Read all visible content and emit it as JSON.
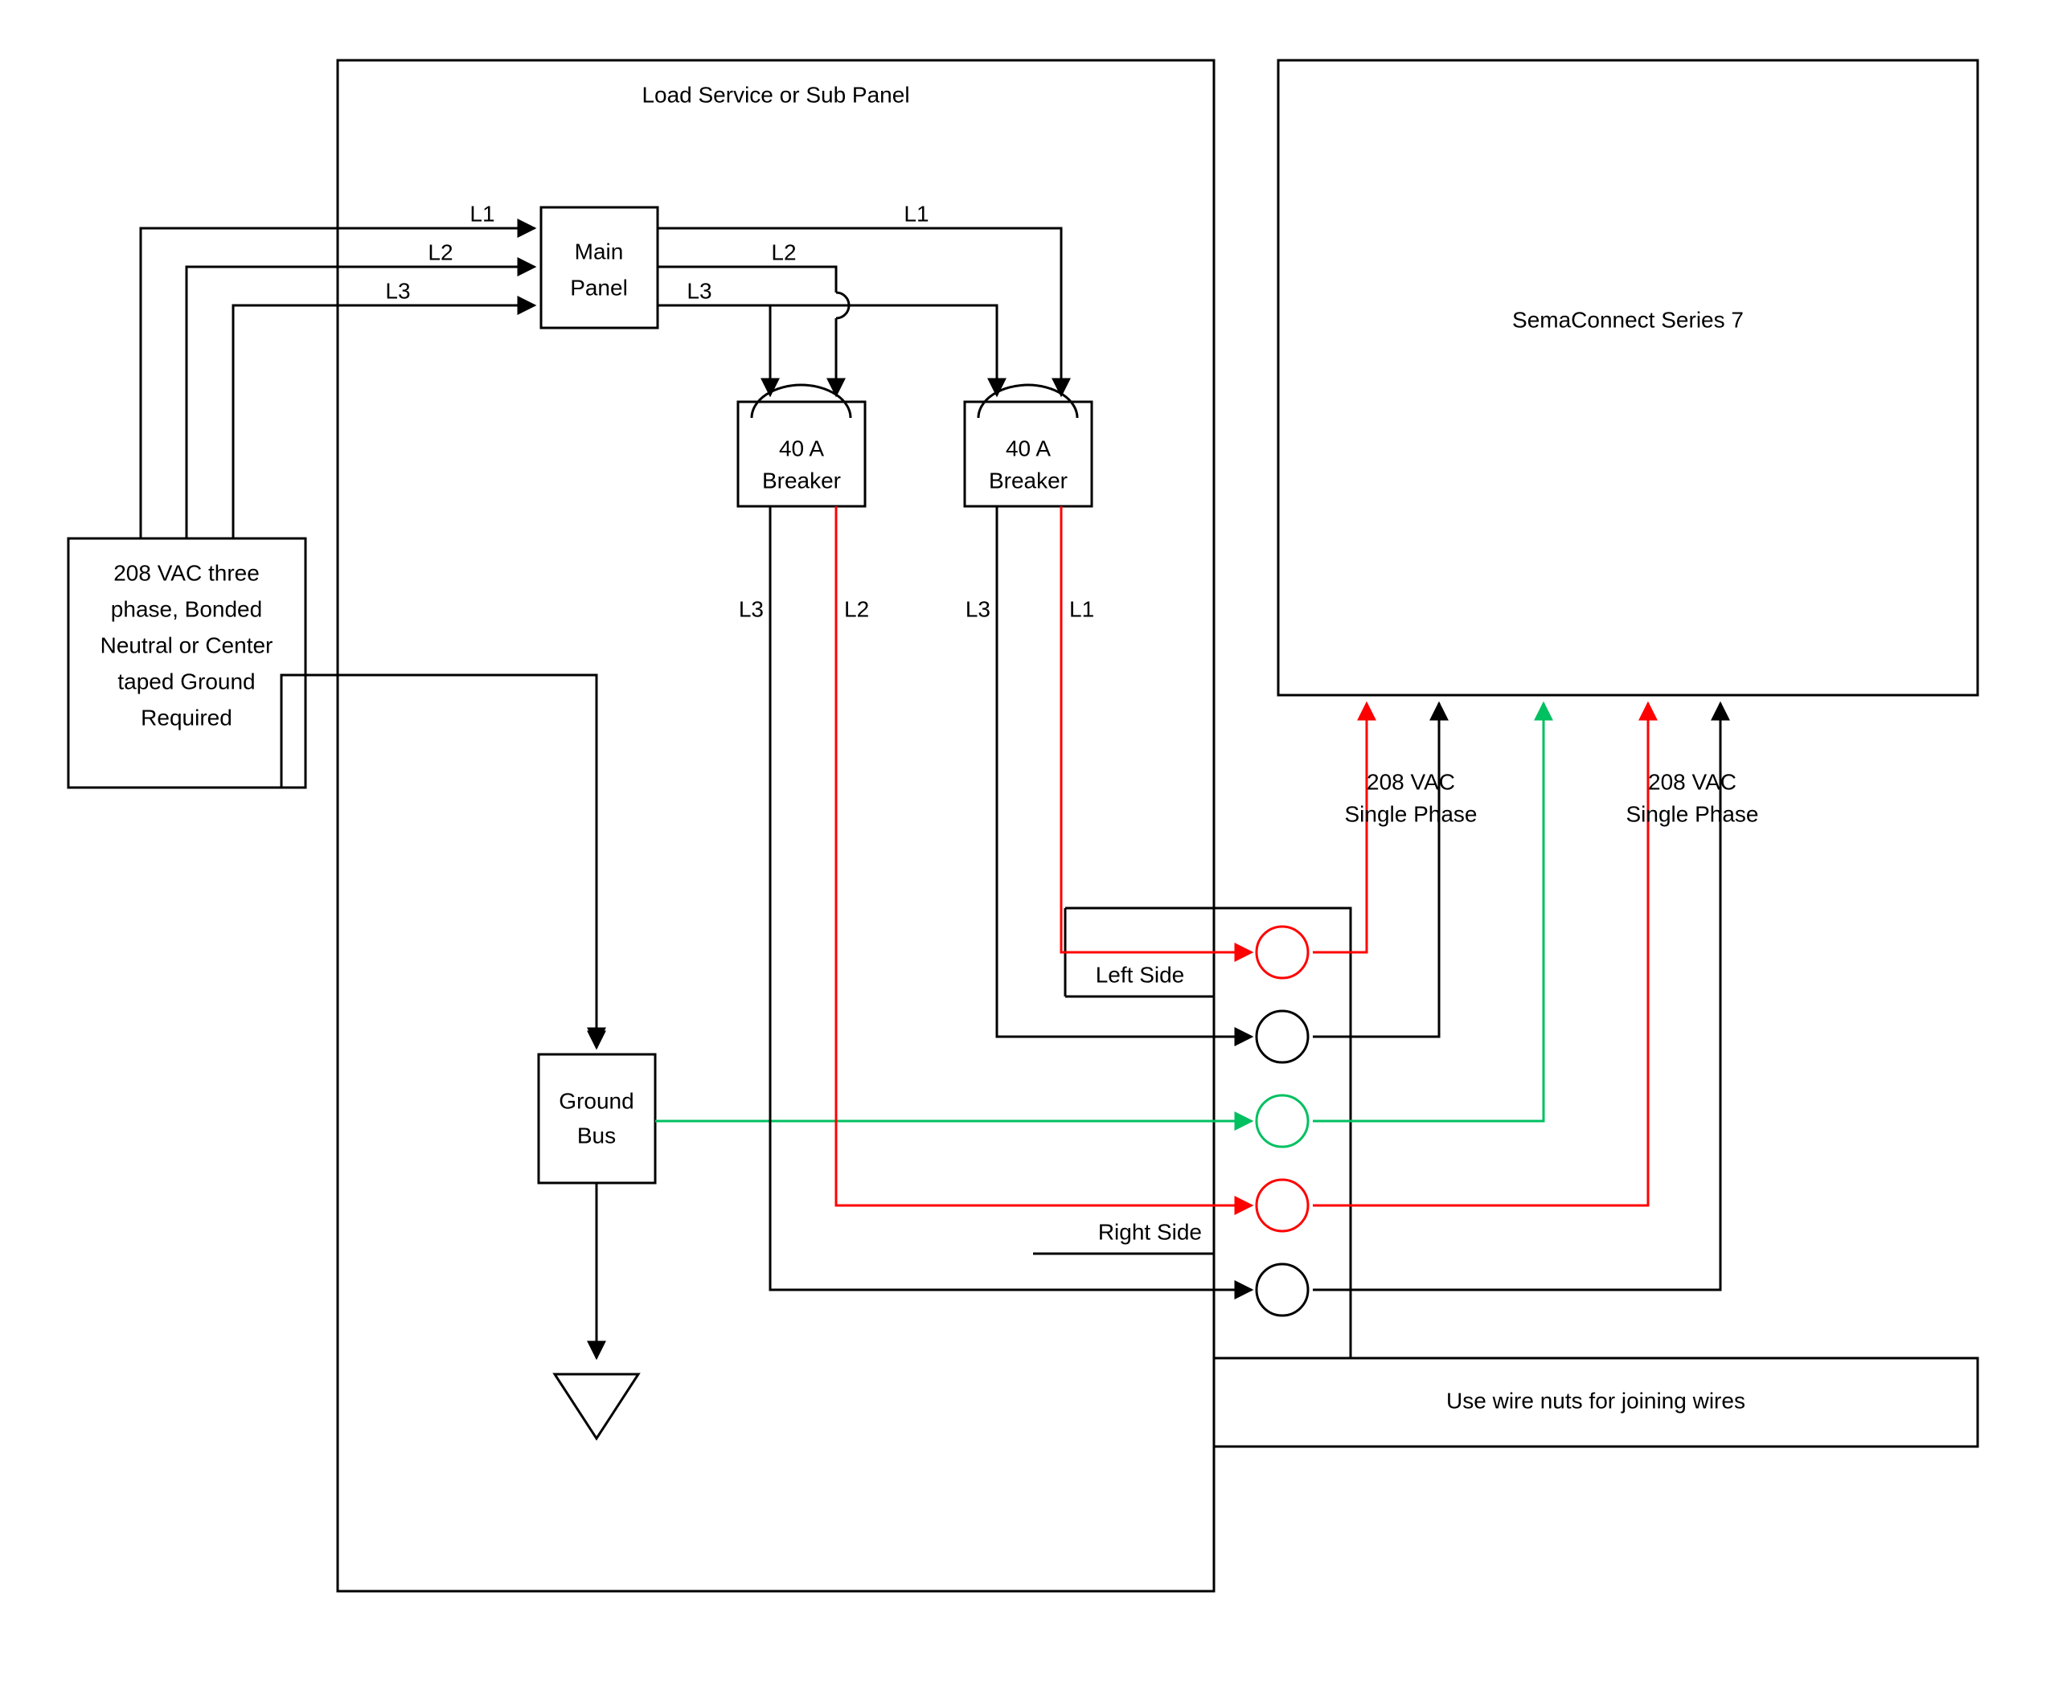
{
  "panel_title": "Load Service or Sub Panel",
  "source_box": {
    "line1": "208 VAC three",
    "line2": "phase, Bonded",
    "line3": "Neutral or Center",
    "line4": "taped Ground",
    "line5": "Required"
  },
  "main_panel": {
    "line1": "Main",
    "line2": "Panel"
  },
  "breaker1": {
    "line1": "40 A",
    "line2": "Breaker"
  },
  "breaker2": {
    "line1": "40 A",
    "line2": "Breaker"
  },
  "ground_bus": {
    "line1": "Ground",
    "line2": "Bus"
  },
  "wires": {
    "L1in": "L1",
    "L2in": "L2",
    "L3in": "L3",
    "L1top": "L1",
    "L2top": "L2",
    "L3top": "L3",
    "b1_L3": "L3",
    "b1_L2": "L2",
    "b2_L3": "L3",
    "b2_L1": "L1"
  },
  "charger_box": "SemaConnect Series 7",
  "phase_label1": {
    "line1": "208 VAC",
    "line2": "Single Phase"
  },
  "phase_label2": {
    "line1": "208 VAC",
    "line2": "Single Phase"
  },
  "left_side": "Left Side",
  "right_side": "Right Side",
  "wire_nuts": "Use wire nuts for joining wires",
  "colors": {
    "black": "#000000",
    "red": "#ff0000",
    "green": "#00c060"
  }
}
